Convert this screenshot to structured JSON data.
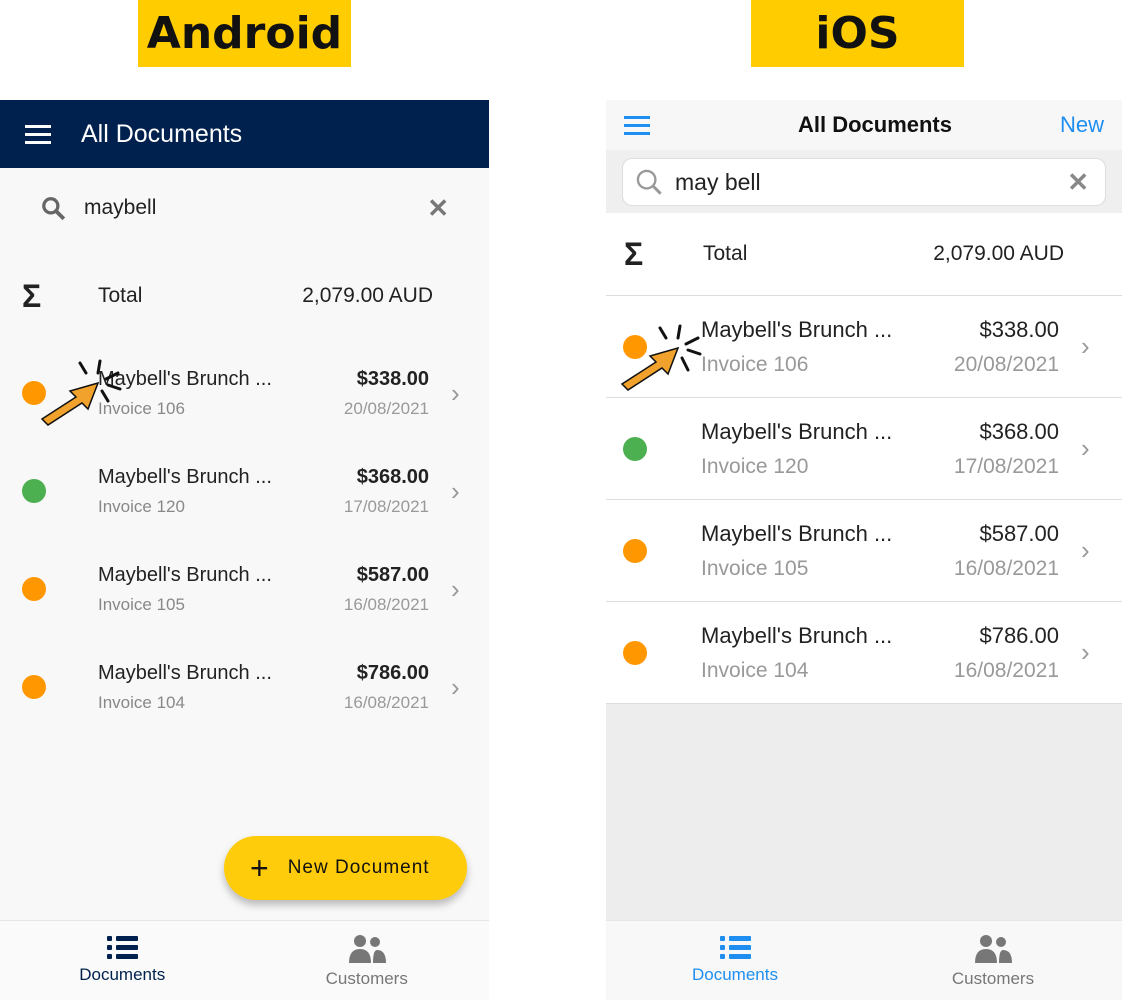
{
  "labels": {
    "android": "Android",
    "ios": "iOS"
  },
  "colors": {
    "android_header": "#00214d",
    "fab": "#ffcc0b",
    "ios_accent": "#1e8ff0",
    "status_orange": "#ff9800",
    "status_green": "#4caf50"
  },
  "android": {
    "title": "All Documents",
    "menu_icon": "hamburger-icon",
    "search_value": "maybell",
    "total": {
      "label": "Total",
      "value": "2,079.00 AUD"
    },
    "rows": [
      {
        "name": "Maybell's Brunch ...",
        "invoice": "Invoice 106",
        "amount": "$338.00",
        "date": "20/08/2021",
        "status": "orange"
      },
      {
        "name": "Maybell's Brunch ...",
        "invoice": "Invoice 120",
        "amount": "$368.00",
        "date": "17/08/2021",
        "status": "green"
      },
      {
        "name": "Maybell's Brunch ...",
        "invoice": "Invoice 105",
        "amount": "$587.00",
        "date": "16/08/2021",
        "status": "orange"
      },
      {
        "name": "Maybell's Brunch ...",
        "invoice": "Invoice 104",
        "amount": "$786.00",
        "date": "16/08/2021",
        "status": "orange"
      }
    ],
    "fab": "New Document",
    "tabs": [
      {
        "label": "Documents",
        "active": true
      },
      {
        "label": "Customers",
        "active": false
      }
    ]
  },
  "ios": {
    "title": "All Documents",
    "new_label": "New",
    "search_value": "may bell",
    "total": {
      "label": "Total",
      "value": "2,079.00 AUD"
    },
    "rows": [
      {
        "name": "Maybell's Brunch ...",
        "invoice": "Invoice 106",
        "amount": "$338.00",
        "date": "20/08/2021",
        "status": "orange"
      },
      {
        "name": "Maybell's Brunch ...",
        "invoice": "Invoice 120",
        "amount": "$368.00",
        "date": "17/08/2021",
        "status": "green"
      },
      {
        "name": "Maybell's Brunch ...",
        "invoice": "Invoice 105",
        "amount": "$587.00",
        "date": "16/08/2021",
        "status": "orange"
      },
      {
        "name": "Maybell's Brunch ...",
        "invoice": "Invoice 104",
        "amount": "$786.00",
        "date": "16/08/2021",
        "status": "orange"
      }
    ],
    "tabs": [
      {
        "label": "Documents",
        "active": true
      },
      {
        "label": "Customers",
        "active": false
      }
    ]
  }
}
